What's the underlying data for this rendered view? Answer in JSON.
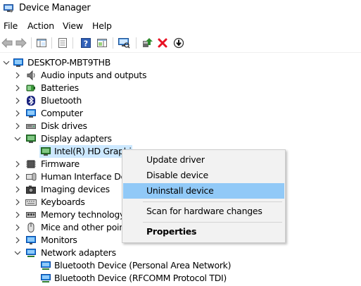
{
  "window": {
    "title": "Device Manager",
    "icon": "device-manager-icon"
  },
  "menu": {
    "items": [
      "File",
      "Action",
      "View",
      "Help"
    ]
  },
  "toolbar": {
    "buttons": [
      "back-icon",
      "forward-icon",
      "show-hide-console-tree-icon",
      "properties-icon",
      "help-icon",
      "action-pane-icon",
      "scan-hardware-icon",
      "update-driver-icon",
      "uninstall-icon",
      "disable-device-icon"
    ]
  },
  "tree": {
    "root": "DESKTOP-MBT9THB",
    "categories": [
      {
        "label": "Audio inputs and outputs",
        "icon": "speaker-icon"
      },
      {
        "label": "Batteries",
        "icon": "battery-icon"
      },
      {
        "label": "Bluetooth",
        "icon": "bluetooth-icon"
      },
      {
        "label": "Computer",
        "icon": "computer-icon"
      },
      {
        "label": "Disk drives",
        "icon": "disk-drive-icon"
      },
      {
        "label": "Display adapters",
        "icon": "display-adapter-icon",
        "expanded": true,
        "children": [
          {
            "label": "Intel(R) HD Graphi",
            "selected": true
          }
        ]
      },
      {
        "label": "Firmware",
        "icon": "firmware-icon"
      },
      {
        "label": "Human Interface Devi",
        "icon": "hid-icon"
      },
      {
        "label": "Imaging devices",
        "icon": "camera-icon"
      },
      {
        "label": "Keyboards",
        "icon": "keyboard-icon"
      },
      {
        "label": "Memory technology d",
        "icon": "memory-icon"
      },
      {
        "label": "Mice and other pointi",
        "icon": "mouse-icon"
      },
      {
        "label": "Monitors",
        "icon": "monitor-icon"
      },
      {
        "label": "Network adapters",
        "icon": "network-adapter-icon",
        "expanded": true,
        "children": [
          {
            "label": "Bluetooth Device (Personal Area Network)"
          },
          {
            "label": "Bluetooth Device (RFCOMM Protocol TDI)"
          }
        ]
      }
    ]
  },
  "context_menu": {
    "items": [
      {
        "label": "Update driver"
      },
      {
        "label": "Disable device"
      },
      {
        "label": "Uninstall device",
        "highlighted": true
      },
      {
        "label": "Scan for hardware changes"
      },
      {
        "label": "Properties",
        "bold": true
      }
    ]
  },
  "colors": {
    "selection": "#cce8ff",
    "menu_highlight": "#91c9f7",
    "menu_bg": "#f2f2f2",
    "uninstall_red": "#e81123",
    "update_green": "#2e8b2e"
  }
}
